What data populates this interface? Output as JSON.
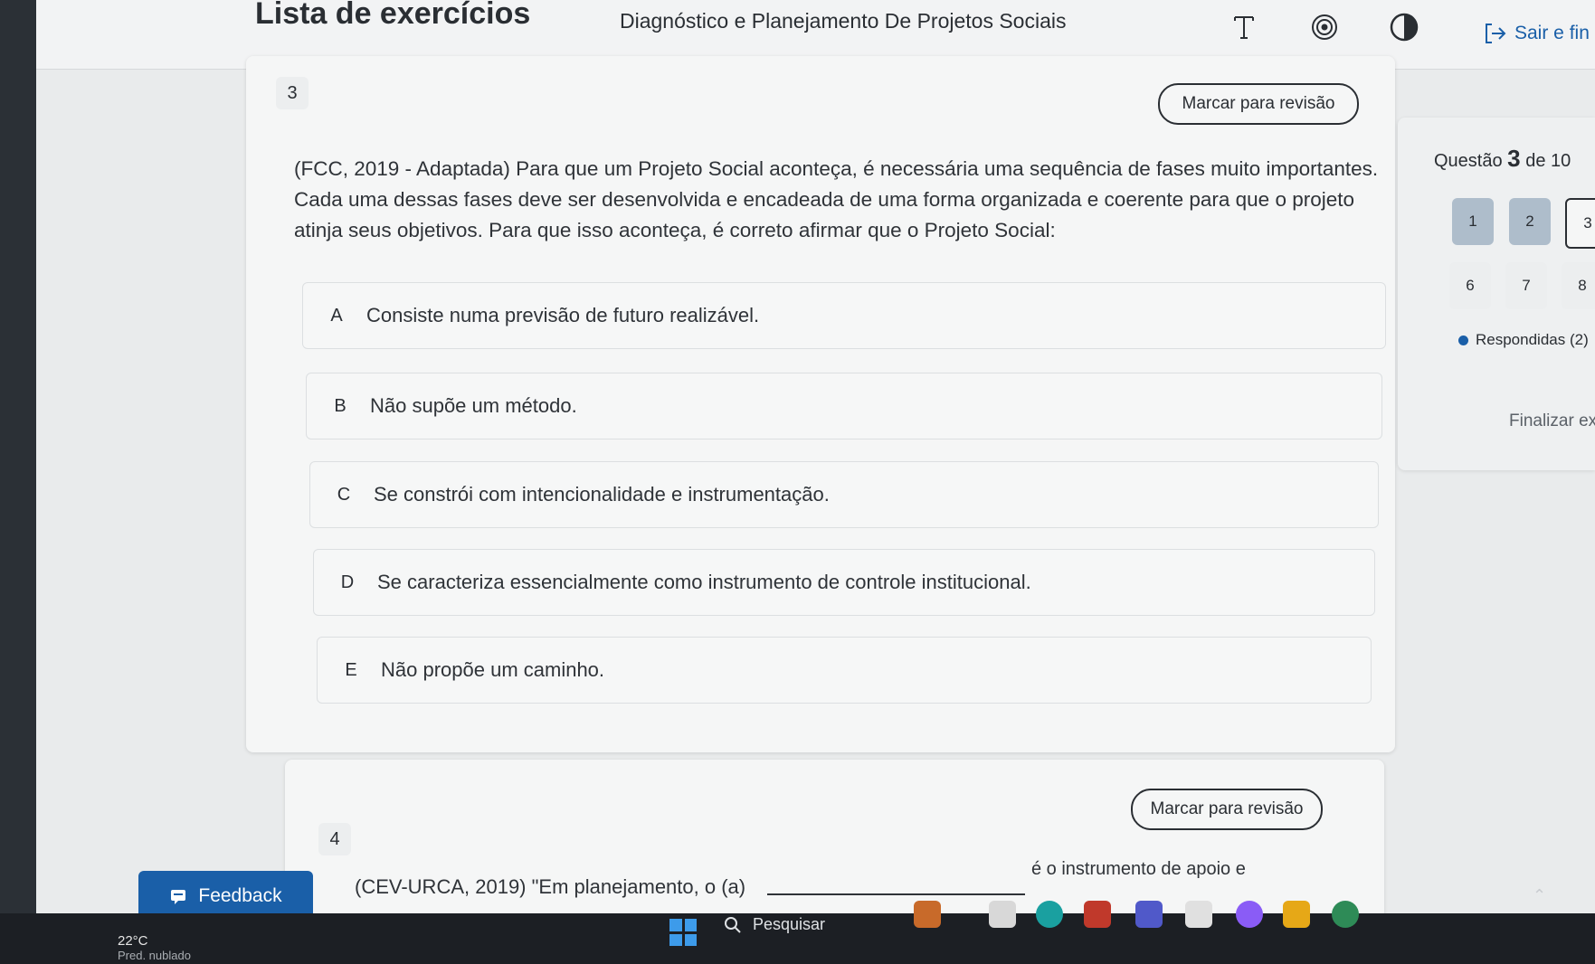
{
  "header": {
    "app_title": "Lista de exercícios",
    "course_title": "Diagnóstico e Planejamento De Projetos Sociais",
    "exit_label": "Sair e fin",
    "icons": [
      "text-size-icon",
      "target-icon",
      "contrast-icon",
      "exit-icon"
    ]
  },
  "question3": {
    "number": "3",
    "review_label": "Marcar para revisão",
    "text": "(FCC, 2019 - Adaptada) Para que um Projeto Social aconteça, é necessária uma sequência de fases muito importantes. Cada uma dessas fases deve ser desenvolvida e encadeada de uma forma organizada e coerente para que o projeto atinja seus objetivos. Para que isso aconteça, é correto afirmar que o Projeto Social:",
    "options": [
      {
        "letter": "A",
        "text": "Consiste numa previsão de futuro realizável."
      },
      {
        "letter": "B",
        "text": "Não supõe um método."
      },
      {
        "letter": "C",
        "text": "Se constrói com intencionalidade e instrumentação."
      },
      {
        "letter": "D",
        "text": "Se caracteriza essencialmente como instrumento de controle institucional."
      },
      {
        "letter": "E",
        "text": "Não propõe um caminho."
      }
    ]
  },
  "navigator": {
    "prefix": "Questão",
    "current": "3",
    "suffix": "de 10",
    "row1": [
      "1",
      "2",
      "3"
    ],
    "row2": [
      "6",
      "7",
      "8"
    ],
    "answered_label": "Respondidas (2)",
    "finish_label": "Finalizar exerc"
  },
  "question4": {
    "number": "4",
    "review_label": "Marcar para revisão",
    "text_start": "(CEV-URCA, 2019) \"Em planejamento, o (a)",
    "text_end": "é o instrumento de apoio e"
  },
  "feedback_label": "Feedback",
  "taskbar": {
    "temperature": "22°C",
    "weather_desc": "Pred. nublado",
    "search_label": "Pesquisar"
  },
  "colors": {
    "accent": "#1a5fa8",
    "answered_bg": "#aebdcb",
    "page_bg": "#e9ebec"
  }
}
